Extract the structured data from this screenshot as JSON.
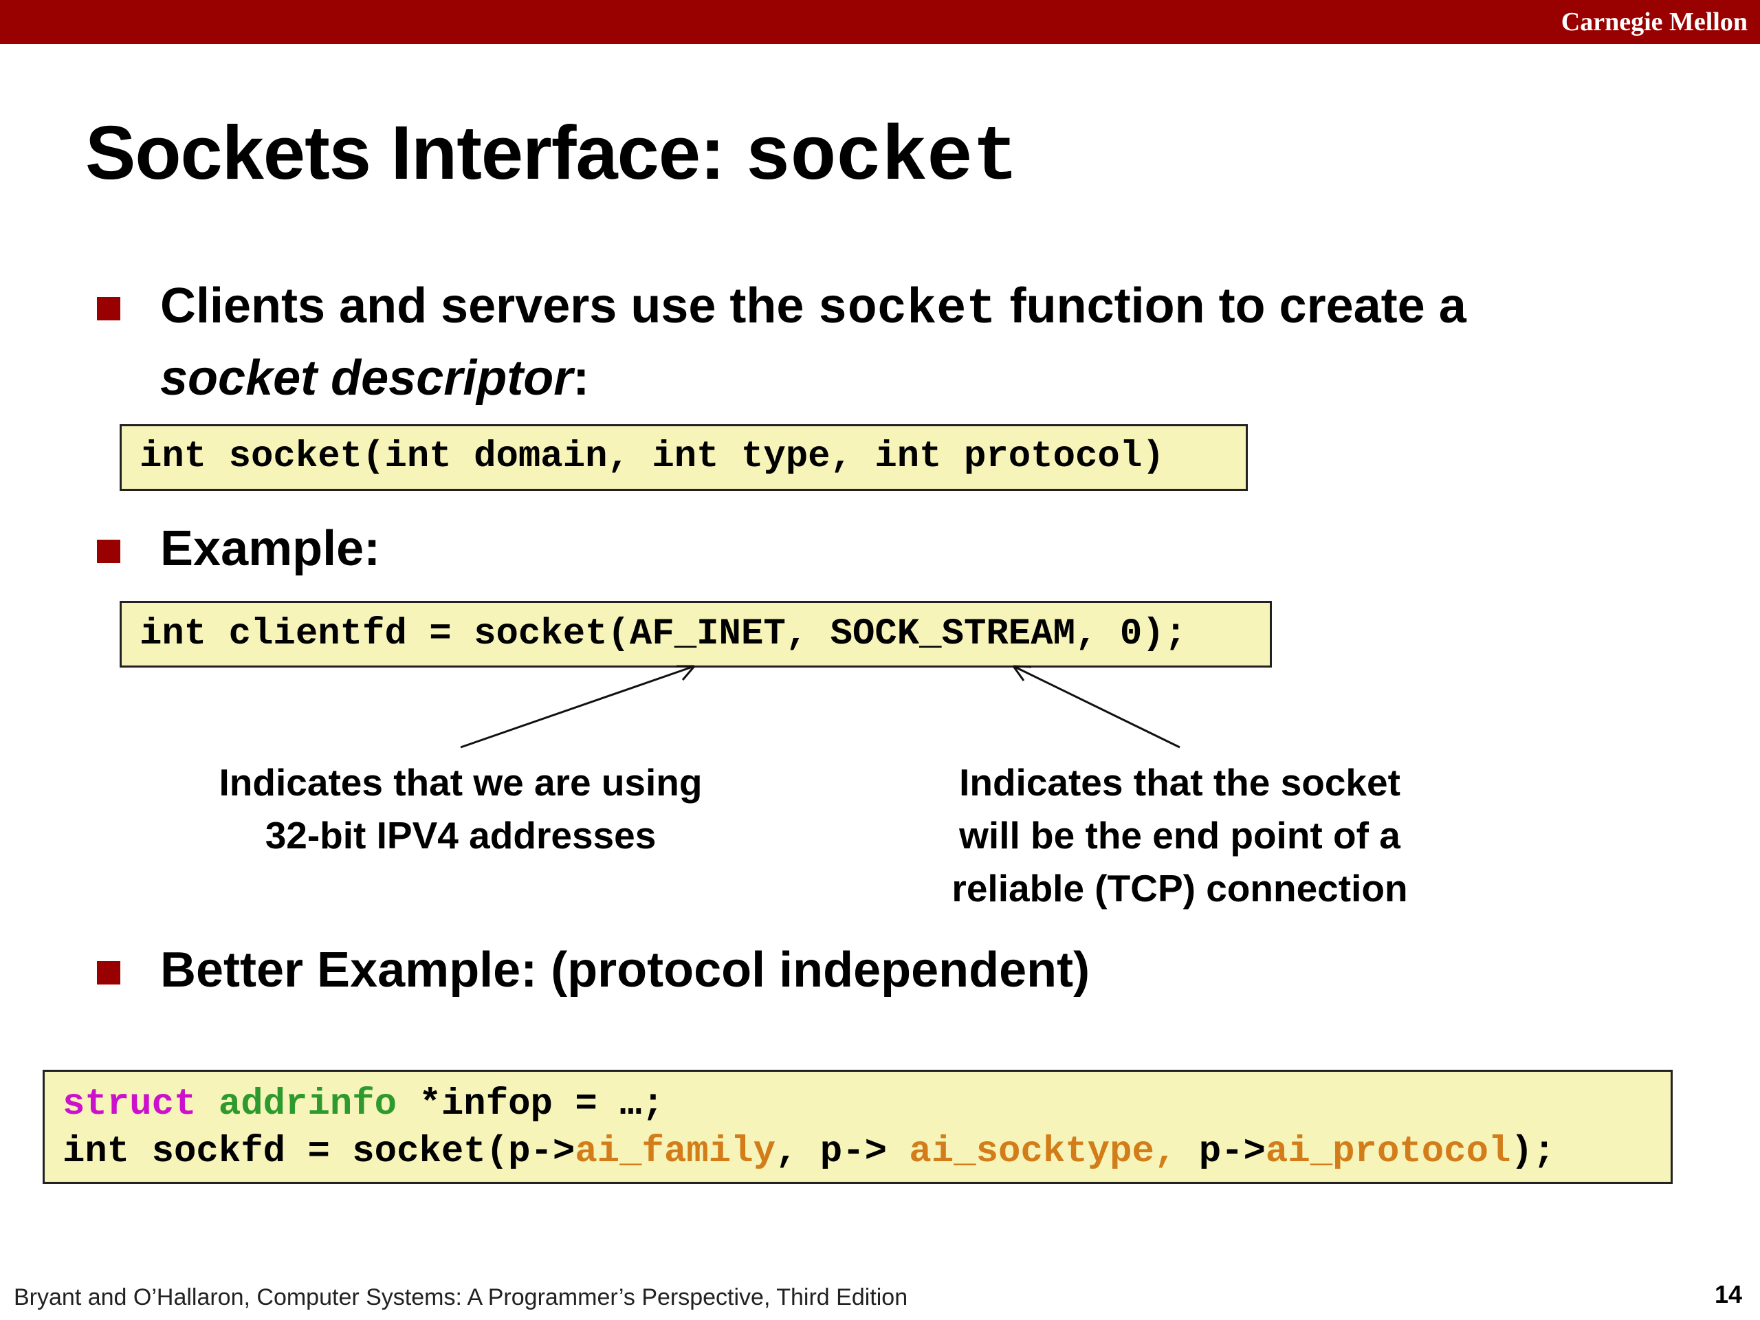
{
  "header": {
    "brand": "Carnegie Mellon"
  },
  "title": {
    "prefix": "Sockets Interface: ",
    "code": "socket"
  },
  "bullet1": {
    "text_before": "Clients and servers use the ",
    "code": "socket",
    "text_after": " function to create a",
    "emphasis": "socket descriptor",
    "suffix": ":"
  },
  "signature": "int socket(int domain, int type, int protocol)",
  "bullet2": {
    "text": "Example:"
  },
  "example": "int clientfd = socket(AF_INET, SOCK_STREAM, 0);",
  "annotations": {
    "left": "Indicates that we are using\n32-bit IPV4 addresses",
    "right": "Indicates that the socket\nwill be the end point of a\nreliable (TCP) connection"
  },
  "bullet3": {
    "text": "Better Example: (protocol independent)"
  },
  "better_example": {
    "line1": {
      "struct": "struct",
      "type": "addrinfo",
      "rest": " *infop = …;"
    },
    "line2": {
      "prefix": "int sockfd = socket(p->",
      "family": "ai_family",
      "mid1": ", p-> ",
      "socktype": "ai_socktype,",
      "mid2": " p->",
      "protocol": "ai_protocol",
      "end": ");"
    }
  },
  "footer": {
    "citation": "Bryant and O’Hallaron, Computer Systems: A Programmer’s Perspective, Third Edition",
    "page_number": "14"
  },
  "colors": {
    "brand_red": "#990000",
    "code_background": "#f6f4b9",
    "struct_keyword": "#cc11cc",
    "type_name": "#2e9a2e",
    "field_name": "#d27d1a"
  }
}
